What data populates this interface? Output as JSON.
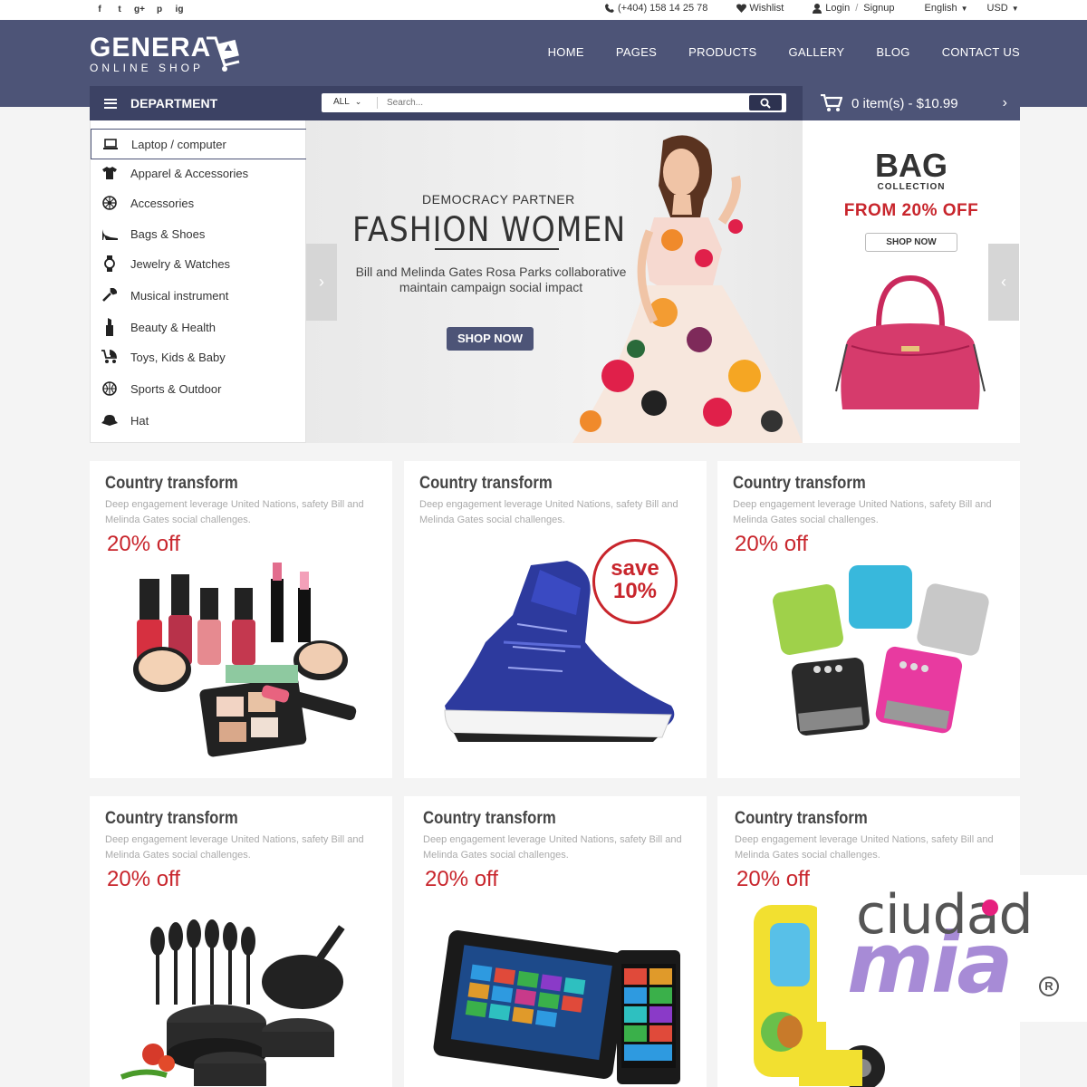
{
  "topbar": {
    "social": [
      "f",
      "t",
      "g+",
      "p",
      "ig"
    ],
    "phone": "(+404) 158 14 25 78",
    "wishlist": "Wishlist",
    "login": "Login",
    "divider": "/",
    "signup": "Signup",
    "language": "English",
    "currency": "USD"
  },
  "header": {
    "logo_main": "GENERA",
    "logo_sub": "ONLINE SHOP",
    "nav": [
      "HOME",
      "PAGES",
      "PRODUCTS",
      "GALLERY",
      "BLOG",
      "CONTACT US"
    ]
  },
  "department": {
    "title": "DEPARTMENT",
    "items": [
      {
        "label": "Laptop / computer",
        "icon": "laptop-icon"
      },
      {
        "label": "Apparel & Accessories",
        "icon": "tshirt-icon"
      },
      {
        "label": "Accessories",
        "icon": "wheel-icon"
      },
      {
        "label": "Bags & Shoes",
        "icon": "heel-shoe-icon"
      },
      {
        "label": "Jewelry & Watches",
        "icon": "watch-icon"
      },
      {
        "label": "Musical instrument",
        "icon": "wrench-icon"
      },
      {
        "label": "Beauty & Health",
        "icon": "lipstick-icon"
      },
      {
        "label": "Toys, Kids & Baby",
        "icon": "stroller-icon"
      },
      {
        "label": "Sports & Outdoor",
        "icon": "ball-icon"
      },
      {
        "label": "Hat",
        "icon": "hat-icon"
      }
    ]
  },
  "search": {
    "category": "ALL",
    "placeholder": "Search..."
  },
  "cart": {
    "summary": "0 item(s) - $10.99"
  },
  "banner": {
    "subtitle": "DEMOCRACY PARTNER",
    "title": "FASHION WOMEN",
    "description": "Bill and Melinda Gates Rosa Parks collaborative maintain campaign social impact",
    "button": "SHOP NOW"
  },
  "promo": {
    "title": "BAG",
    "subtitle": "COLLECTION",
    "offer": "FROM 20% OFF",
    "button": "SHOP NOW"
  },
  "cards": [
    {
      "title": "Country transform",
      "desc": "Deep engagement leverage United Nations, safety Bill and Melinda Gates social challenges.",
      "price": "20% off",
      "image": "cosmetics"
    },
    {
      "title": "Country transform",
      "desc": "Deep engagement leverage United Nations, safety Bill and Melinda Gates social challenges.",
      "badge": "save 10%",
      "image": "sneaker"
    },
    {
      "title": "Country transform",
      "desc": "Deep engagement leverage United Nations, safety Bill and Melinda Gates social challenges.",
      "price": "20% off",
      "image": "speakers"
    },
    {
      "title": "Country transform",
      "desc": "Deep engagement leverage United Nations, safety Bill and Melinda Gates social challenges.",
      "price": "20% off",
      "image": "cookware"
    },
    {
      "title": "Country transform",
      "desc": "Deep engagement leverage United Nations, safety Bill and Melinda Gates social challenges.",
      "price": "20% off",
      "image": "tablet-phone"
    },
    {
      "title": "Country transform",
      "desc": "Deep engagement leverage United Nations, safety Bill and Melinda Gates social challenges.",
      "price": "20% off",
      "image": "toy-truck"
    }
  ],
  "save_badge": {
    "line1": "save",
    "line2": "10%"
  },
  "watermark": {
    "line1": "ciudad",
    "line2": "mia",
    "reg": "R"
  },
  "colors": {
    "header": "#4d5477",
    "dark": "#3c4264",
    "accent": "#c8252c"
  }
}
